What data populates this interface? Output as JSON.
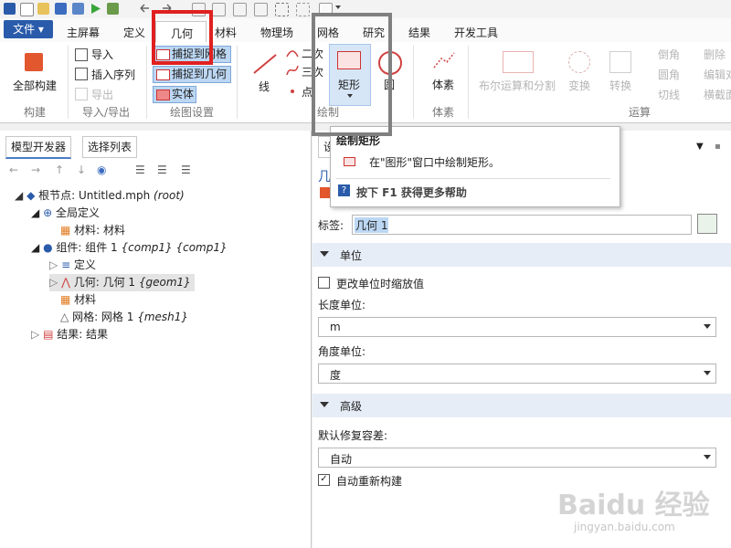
{
  "qat": {
    "icons": [
      "new-icon",
      "open-icon",
      "save-icon",
      "save-as-icon",
      "run-icon",
      "undo-icon",
      "redo-icon",
      "copy-icon",
      "paste-icon",
      "duplicate-icon",
      "delete-icon",
      "select-icon",
      "deselect-icon",
      "filter-icon",
      "more-icon"
    ]
  },
  "tabs": {
    "file": "文件 ▾",
    "items": [
      "主屏幕",
      "定义",
      "几何",
      "材料",
      "物理场",
      "网格",
      "研究",
      "结果",
      "开发工具"
    ],
    "active": "几何"
  },
  "ribbon": {
    "build_all": "全部构建",
    "group_build": "构建",
    "import": "导入",
    "insert_seq": "插入序列",
    "export": "导出",
    "group_import_export": "导入/导出",
    "snap_grid": "捕捉到网格",
    "snap_geom": "捕捉到几何",
    "solid": "实体",
    "group_draw_settings": "绘图设置",
    "line": "线",
    "quadratic": "二次",
    "cubic": "三次",
    "point": "点",
    "rectangle": "矩形",
    "circle": "圆",
    "group_draw": "绘制",
    "primitives": "体素",
    "group_primitives": "体素",
    "boolean": "布尔运算和分割",
    "transform": "变换",
    "convert": "转换",
    "chamfer": "倒角",
    "fillet": "圆角",
    "tangent": "切线",
    "delete": "删除",
    "edit": "编辑对",
    "cross_section": "横截面",
    "group_operations": "运算"
  },
  "tooltip": {
    "title": "绘制矩形",
    "description": "在\"图形\"窗口中绘制矩形。",
    "help": "按下 F1 获得更多帮助"
  },
  "left_panel": {
    "tabs": [
      "模型开发器",
      "选择列表"
    ],
    "tree": {
      "root": "根节点: Untitled.mph",
      "root_tag": "(root)",
      "global_defs": "全局定义",
      "materials_global": "材料: 材料",
      "component": "组件: 组件 1",
      "component_tag": "{comp1} {comp1}",
      "definitions": "定义",
      "geometry": "几何: 几何 1",
      "geometry_tag": "{geom1}",
      "materials": "材料",
      "mesh": "网格: 网格 1",
      "mesh_tag": "{mesh1}",
      "results": "结果: 结果"
    }
  },
  "right_panel": {
    "tab_label": "设",
    "title_partial": "几",
    "label_caption": "标签:",
    "label_value": "几何 1",
    "section_units": "单位",
    "scale_units_checkbox": "更改单位时缩放值",
    "scale_units_checked": false,
    "length_unit_caption": "长度单位:",
    "length_unit_value": "m",
    "angle_unit_caption": "角度单位:",
    "angle_unit_value": "度",
    "section_advanced": "高级",
    "repair_tol_caption": "默认修复容差:",
    "repair_tol_value": "自动",
    "auto_rebuild_checkbox": "自动重新构建",
    "auto_rebuild_checked": true
  },
  "watermark": {
    "brand": "Baidu 经验",
    "url": "jingyan.baidu.com"
  },
  "colors": {
    "file_menu": "#2a5bab",
    "highlight_red": "#e02020",
    "highlight_gray": "#808080",
    "chip_bg": "#bcd7f3",
    "section_bg": "#e6edf6"
  }
}
